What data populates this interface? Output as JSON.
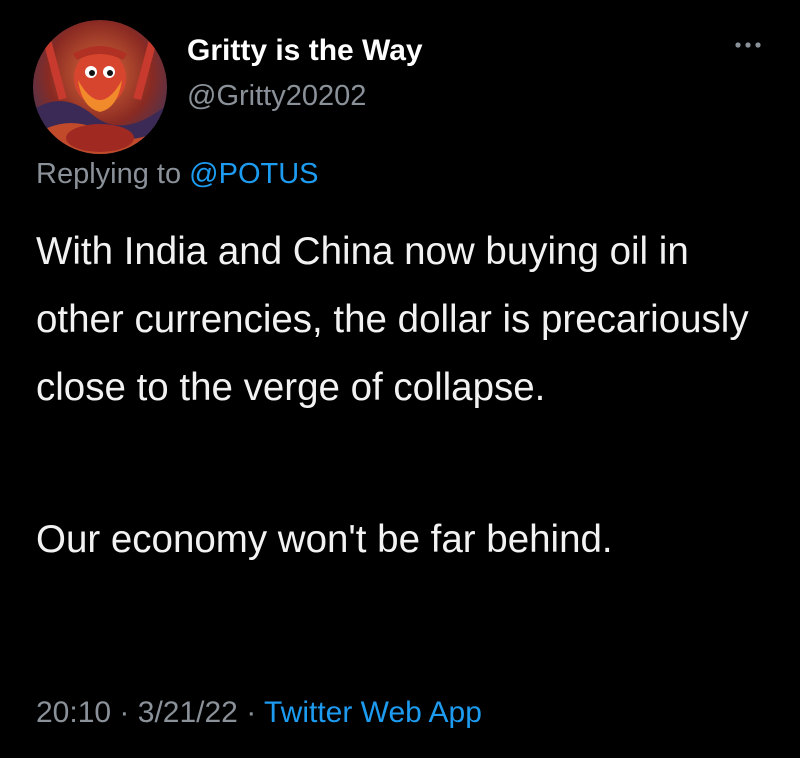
{
  "tweet": {
    "display_name": "Gritty is the Way",
    "handle": "@Gritty20202",
    "more_icon": "ellipsis-icon",
    "reply_prefix": "Replying to",
    "reply_mention": "@POTUS",
    "paragraphs": [
      "With India and China now buying oil in other currencies, the dollar is precariously close to the verge of collapse.",
      "Our economy won't be far behind."
    ],
    "time": "20:10",
    "date": "3/21/22",
    "separator": "·",
    "source": "Twitter Web App"
  },
  "colors": {
    "background": "#000000",
    "primary_text": "#f2f2f2",
    "secondary_text": "#8b9199",
    "link": "#1d9bf0"
  }
}
